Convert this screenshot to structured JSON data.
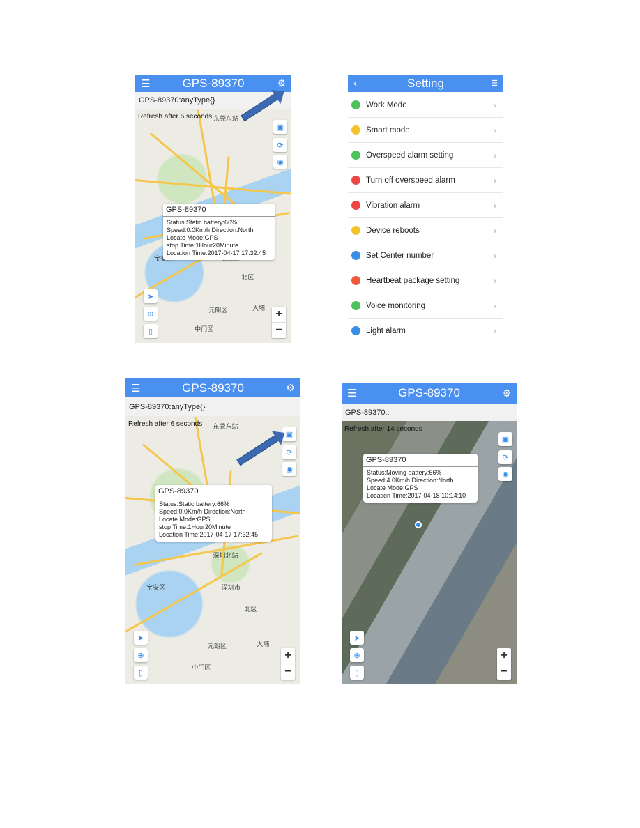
{
  "device_title": "GPS-89370",
  "menu_icon": "hamburger-menu-icon",
  "settings_icon": "gear-icon",
  "panels": {
    "a": {
      "subtitle": "GPS-89370:anyType{}",
      "refresh": "Refresh after 6 seconds",
      "popup": {
        "title": "GPS-89370",
        "lines": [
          "Status:Static battery:66%",
          "Speed:0.0Km/h     Direction:North",
          "Locate Mode:GPS",
          "stop Time:1Hour20Minute",
          "Location Time:2017-04-17 17:32:45"
        ]
      }
    },
    "c": {
      "subtitle": "GPS-89370:anyType{}",
      "refresh": "Refresh after 6 seconds",
      "popup": {
        "title": "GPS-89370",
        "lines": [
          "Status:Static battery:66%",
          "Speed:0.0Km/h     Direction:North",
          "Locate Mode:GPS",
          "stop Time:1Hour20Minute",
          "Location Time:2017-04-17 17:32:45"
        ]
      }
    },
    "d": {
      "subtitle": "GPS-89370::",
      "refresh": "Refresh after 14 seconds",
      "popup": {
        "title": "GPS-89370",
        "lines": [
          "Status:Moving battery:66%",
          "Speed:4.0Km/h     Direction:North",
          "Locate Mode:GPS",
          "Location Time:2017-04-18 10:14:10"
        ]
      }
    }
  },
  "map_labels": [
    "宝安区",
    "深圳市",
    "北区",
    "元朗区",
    "大埔",
    "中门区",
    "深圳北站",
    "东莞东站"
  ],
  "zoom_in": "+",
  "zoom_out": "−",
  "setting": {
    "title": "Setting",
    "back": "‹",
    "items": [
      {
        "label": "Work Mode",
        "color": "#4cc25a"
      },
      {
        "label": "Smart mode",
        "color": "#f5c22a"
      },
      {
        "label": "Overspeed alarm setting",
        "color": "#4cc25a"
      },
      {
        "label": "Turn off overspeed alarm",
        "color": "#ef4545"
      },
      {
        "label": "Vibration alarm",
        "color": "#ef4545"
      },
      {
        "label": "Device reboots",
        "color": "#f5c22a"
      },
      {
        "label": "Set Center number",
        "color": "#3a8ee6"
      },
      {
        "label": "Heartbeat package setting",
        "color": "#f05a3a"
      },
      {
        "label": "Voice monitoring",
        "color": "#4cc25a"
      },
      {
        "label": "Light alarm",
        "color": "#3a8ee6"
      }
    ]
  },
  "colors": {
    "header": "#4a90f0",
    "arrow": "#3b6ab3"
  }
}
